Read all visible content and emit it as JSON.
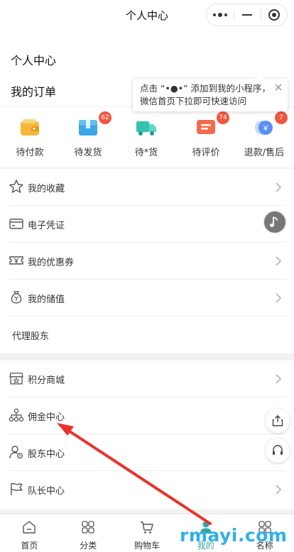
{
  "nav": {
    "title": "个人中心"
  },
  "header": {
    "page_title": "个人中心",
    "orders_title": "我的订单"
  },
  "tip": {
    "line1": "点击 “•●•” 添加到我的小程序，",
    "line2": "微信首页下拉即可快速访问"
  },
  "orders": [
    {
      "label": "待付款",
      "icon": "wallet-icon",
      "color": "#f6b73c",
      "badge": ""
    },
    {
      "label": "待发货",
      "icon": "package-icon",
      "color": "#3aa6e8",
      "badge": "62"
    },
    {
      "label": "待*货",
      "icon": "truck-icon",
      "color": "#33c3ad",
      "badge": ""
    },
    {
      "label": "待评价",
      "icon": "comment-icon",
      "color": "#f26b4a",
      "badge": "74"
    },
    {
      "label": "退款/售后",
      "icon": "refund-icon",
      "color": "#5b8ff3",
      "badge": "7"
    }
  ],
  "menu_a": [
    {
      "label": "我的收藏",
      "icon": "star-icon"
    },
    {
      "label": "电子凭证",
      "icon": "card-icon"
    },
    {
      "label": "我的优惠券",
      "icon": "coupon-icon"
    },
    {
      "label": "我的储值",
      "icon": "money-bag-icon"
    },
    {
      "label": "代理股东",
      "icon": ""
    }
  ],
  "menu_b": [
    {
      "label": "积分商城",
      "icon": "shop-icon"
    },
    {
      "label": "佣金中心",
      "icon": "network-icon"
    },
    {
      "label": "股东中心",
      "icon": "user-gear-icon"
    },
    {
      "label": "队长中心",
      "icon": "flag-icon"
    }
  ],
  "tabs": [
    {
      "label": "首页",
      "icon": "home-icon",
      "active": false
    },
    {
      "label": "分类",
      "icon": "grid-icon",
      "active": false
    },
    {
      "label": "购物车",
      "icon": "cart-icon",
      "active": false
    },
    {
      "label": "我的",
      "icon": "user-icon",
      "active": true
    },
    {
      "label": "名称",
      "icon": "grid-icon",
      "active": false
    }
  ],
  "colors": {
    "accent": "#38a5a0",
    "badge": "#f15540",
    "annotation_arrow": "#e8342c",
    "watermark": "#2fb0ea"
  },
  "watermark": "rmayi.com"
}
